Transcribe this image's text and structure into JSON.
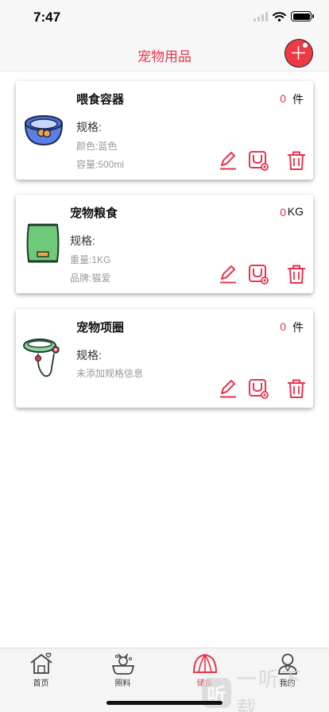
{
  "status": {
    "time": "7:47"
  },
  "nav": {
    "title": "宠物用品"
  },
  "items": [
    {
      "name": "喂食容器",
      "quantity": "0",
      "unit": "件",
      "spec_title": "规格:",
      "spec_lines": [
        "颜色:蓝色",
        "容量:500ml"
      ]
    },
    {
      "name": "宠物粮食",
      "quantity": "0",
      "unit": "KG",
      "spec_title": "规格:",
      "spec_lines": [
        "重量:1KG",
        "品牌:猫爱"
      ]
    },
    {
      "name": "宠物项圈",
      "quantity": "0",
      "unit": "件",
      "spec_title": "规格:",
      "spec_lines": [
        "未添加规格信息"
      ]
    }
  ],
  "tabs": [
    {
      "label": "首页",
      "icon": "house-icon"
    },
    {
      "label": "照料",
      "icon": "pet-bath-icon"
    },
    {
      "label": "储备",
      "icon": "tent-icon",
      "active": true
    },
    {
      "label": "我的",
      "icon": "person-icon"
    }
  ],
  "watermark": {
    "badge": "听",
    "text": "一听下载"
  },
  "colors": {
    "accent": "#e8344e",
    "add_button": "#ee3a44",
    "bowl": "#5b7fe6",
    "food_bag": "#6fc97a",
    "collar": "#8ed5a6"
  }
}
